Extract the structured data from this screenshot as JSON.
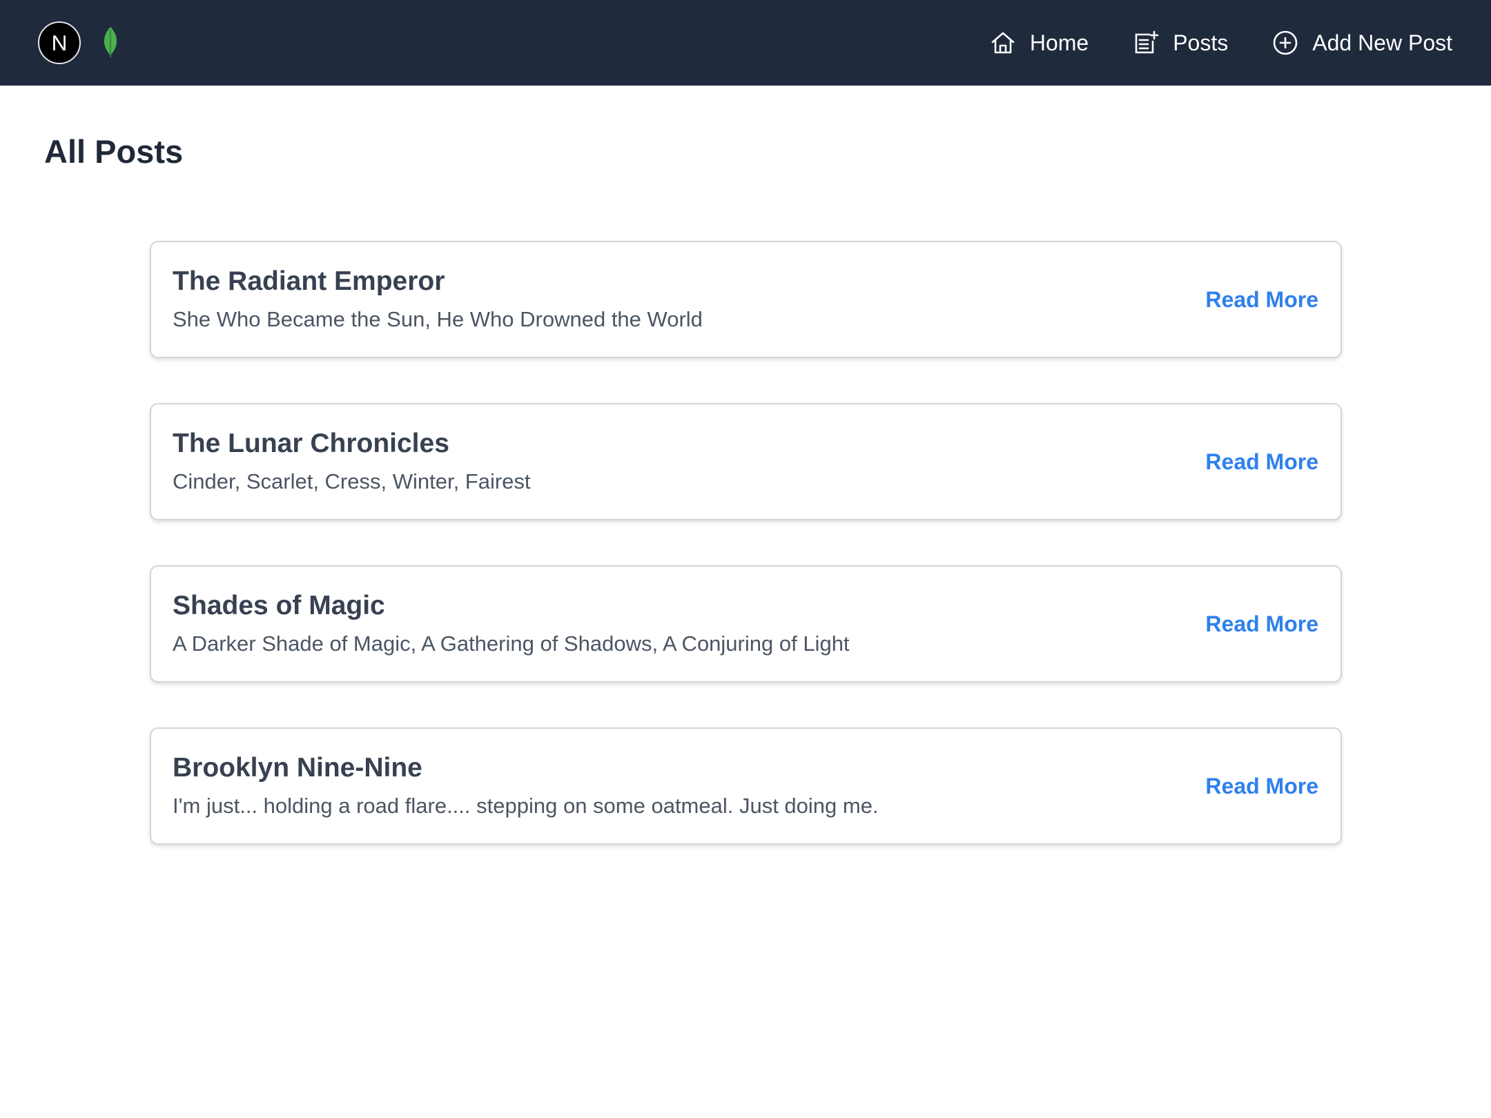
{
  "nav": {
    "logos": [
      {
        "name": "nextjs-logo-icon",
        "letter": "N"
      },
      {
        "name": "mongodb-leaf-icon"
      }
    ],
    "links": [
      {
        "label": "Home",
        "icon": "home-icon"
      },
      {
        "label": "Posts",
        "icon": "note-add-icon"
      },
      {
        "label": "Add New Post",
        "icon": "circle-plus-icon"
      }
    ]
  },
  "page": {
    "title": "All Posts"
  },
  "posts": [
    {
      "title": "The Radiant Emperor",
      "subtitle": "She Who Became the Sun, He Who Drowned the World",
      "action": "Read More"
    },
    {
      "title": "The Lunar Chronicles",
      "subtitle": "Cinder, Scarlet, Cress, Winter, Fairest",
      "action": "Read More"
    },
    {
      "title": "Shades of Magic",
      "subtitle": "A Darker Shade of Magic, A Gathering of Shadows, A Conjuring of Light",
      "action": "Read More"
    },
    {
      "title": "Brooklyn Nine-Nine",
      "subtitle": "I'm just... holding a road flare.... stepping on some oatmeal. Just doing me.",
      "action": "Read More"
    }
  ],
  "colors": {
    "navbar_bg": "#1f2a3c",
    "link_accent": "#2f80ed",
    "mongo_green": "#4caf50"
  }
}
